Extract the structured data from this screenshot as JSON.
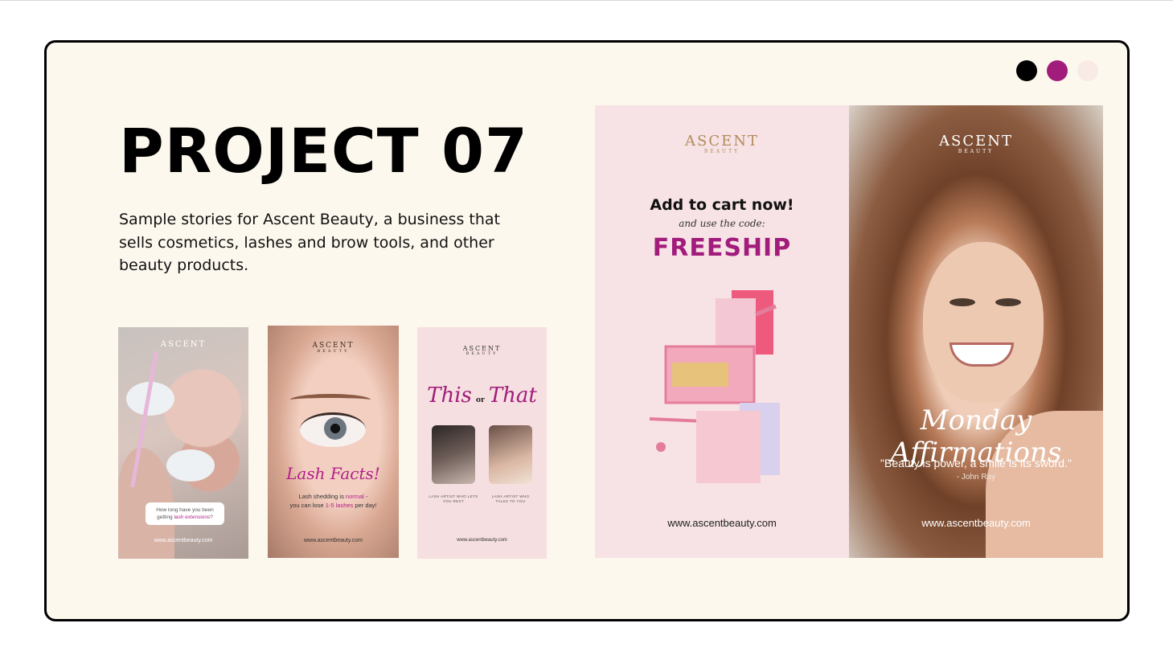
{
  "header": {
    "title": "PROJECT 07",
    "description": "Sample stories for Ascent Beauty, a business that sells cosmetics, lashes and brow tools, and other beauty products."
  },
  "palette": [
    "#000000",
    "#a11c7b",
    "#f8ebe6"
  ],
  "brand": {
    "logo": "ASCENT",
    "logo_sub": "BEAUTY"
  },
  "stories": {
    "lash_question": {
      "question_a": "How long have you been getting ",
      "question_b": "lash extensions",
      "question_c": "?",
      "url": "www.ascentbeauty.com"
    },
    "lash_facts": {
      "heading": "Lash Facts!",
      "line1_a": "Lash shedding is ",
      "line1_b": "normal",
      "line1_c": " -",
      "line2_a": "you can lose ",
      "line2_b": "1-5 lashes",
      "line2_c": " per day!",
      "url": "www.ascentbeauty.com"
    },
    "this_or_that": {
      "this": "This",
      "or": "or",
      "that": "That",
      "caption_left": "LASH ARTIST WHO LETS YOU REST",
      "caption_right": "LASH ARTIST WHO TALKS TO YOU",
      "url": "www.ascentbeauty.com"
    },
    "freeship": {
      "cta": "Add to cart now!",
      "sub": "and use the code:",
      "code": "FREESHIP",
      "url": "www.ascentbeauty.com"
    },
    "affirmations": {
      "heading": "Monday Affirmations",
      "quote": "\"Beauty is power, a smile is its sword.\"",
      "author": "- John Ray",
      "url": "www.ascentbeauty.com"
    }
  }
}
